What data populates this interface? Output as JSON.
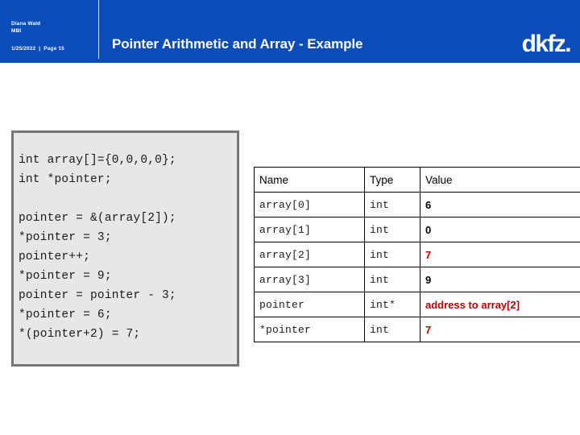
{
  "header": {
    "author": "Diana Wald",
    "department": "MBI",
    "date": "1/25/2022",
    "separator": "|",
    "page": "Page 15",
    "title": "Pointer Arithmetic and Array - Example",
    "logo_text": "dkfz.",
    "background_color": "#0a4cb8"
  },
  "code": {
    "text": "int array[]={0,0,0,0};\nint *pointer;\n\npointer = &(array[2]);\n*pointer = 3;\npointer++;\n*pointer = 9;\npointer = pointer - 3;\n*pointer = 6;\n*(pointer+2) = 7;",
    "background_color": "#e7e7e7",
    "border_color": "#767676"
  },
  "table": {
    "columns": [
      "Name",
      "Type",
      "Value"
    ],
    "highlight_color": "#c00000",
    "rows": [
      {
        "name": "array[0]",
        "type": "int",
        "value": "6",
        "highlight": false
      },
      {
        "name": "array[1]",
        "type": "int",
        "value": "0",
        "highlight": false
      },
      {
        "name": "array[2]",
        "type": "int",
        "value": "7",
        "highlight": true
      },
      {
        "name": "array[3]",
        "type": "int",
        "value": "9",
        "highlight": false
      },
      {
        "name": "pointer",
        "type": "int*",
        "value": "address to array[2]",
        "highlight": true
      },
      {
        "name": "*pointer",
        "type": "int",
        "value": "7",
        "highlight": true
      }
    ]
  }
}
